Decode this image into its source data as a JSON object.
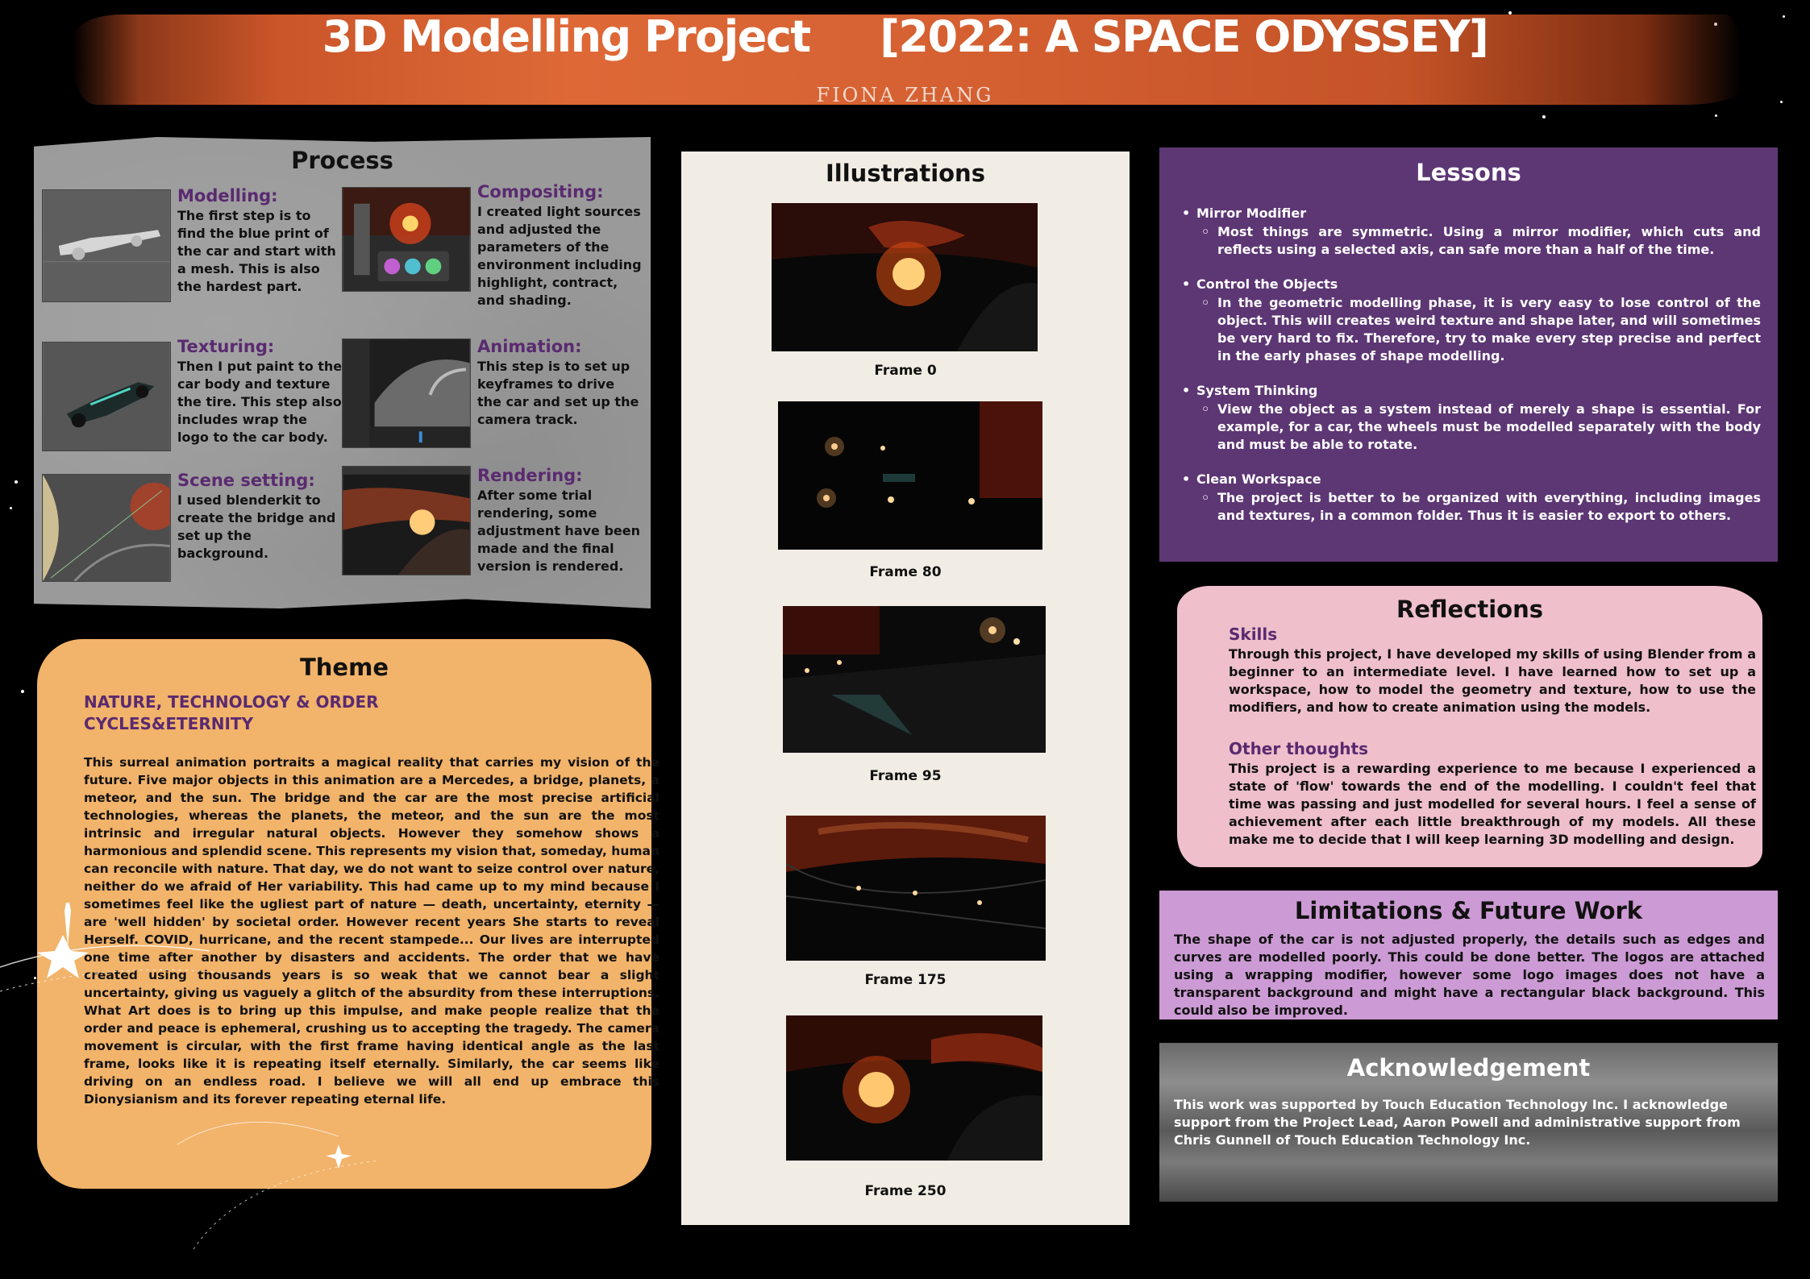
{
  "header": {
    "title": "3D Modelling Project     [2022: A SPACE ODYSSEY]",
    "author": "FIONA ZHANG"
  },
  "process": {
    "title": "Process",
    "steps": [
      {
        "heading": "Modelling:",
        "text": "The first step is to find the blue print of the car and start with a mesh. This is also the hardest part."
      },
      {
        "heading": "Compositing:",
        "text": "I created light sources and adjusted the parameters of the environment including highlight, contract, and shading."
      },
      {
        "heading": "Texturing:",
        "text": "Then I put paint to the car body and texture the tire. This step also includes wrap the logo to the car body."
      },
      {
        "heading": "Animation:",
        "text": "This step is to set up keyframes to drive the car and set up the camera track."
      },
      {
        "heading": "Scene setting:",
        "text": "I used blenderkit to create the bridge and set up the background."
      },
      {
        "heading": "Rendering:",
        "text": "After some trial rendering, some adjustment have been made and the final version is rendered."
      }
    ]
  },
  "theme": {
    "title": "Theme",
    "sub1": "NATURE, TECHNOLOGY & ORDER",
    "sub2": "CYCLES&ETERNITY",
    "body": "This surreal animation portraits a magical reality that carries my vision of the future. Five major objects in this animation are a Mercedes, a bridge, planets, a meteor, and the sun. The bridge and the car are the most precise artificial technologies, whereas the planets, the meteor, and the sun are the most intrinsic and irregular natural objects. However they somehow shows a harmonious and splendid scene. This represents my vision that, someday, human can reconcile with nature. That day, we do not want to seize control over nature, neither do we afraid of Her variability. This had came up to my mind because I sometimes feel like the ugliest part of nature — death, uncertainty, eternity — are 'well hidden' by societal order. However recent years She starts to reveal Herself. COVID, hurricane, and the recent stampede... Our lives are interrupted one time after another by disasters and accidents. The order that we have created using thousands years is so weak that we cannot bear a slight uncertainty, giving us vaguely a glitch of  the absurdity from these interruptions. What Art does is to bring up this impulse, and make people realize that the order and peace is ephemeral, crushing us to accepting the tragedy. The camera movement is circular, with the first frame having identical angle as the last frame, looks like it is repeating itself eternally. Similarly, the car seems like driving on an endless road. I believe we will all end up embrace this Dionysianism and its forever repeating eternal life."
  },
  "illustrations": {
    "title": "Illustrations",
    "frames": [
      "Frame 0",
      "Frame 80",
      "Frame 95",
      "Frame 175",
      "Frame 250"
    ]
  },
  "lessons": {
    "title": "Lessons",
    "items": [
      {
        "head": "Mirror Modifier",
        "text": "Most things are symmetric. Using a mirror modifier, which cuts and reflects using a selected axis, can safe more than a half of the time."
      },
      {
        "head": "Control the Objects",
        "text": "In the geometric modelling phase, it is very easy to lose control of the object. This will creates weird texture and shape later, and will sometimes be very hard to fix. Therefore, try to make every step precise and perfect in the early phases of shape modelling."
      },
      {
        "head": "System Thinking",
        "text": "View the object as a system instead of merely a shape is essential. For example, for a car, the wheels must be modelled separately with the body and must be able to rotate."
      },
      {
        "head": "Clean Workspace",
        "text": "The project is better to be organized with everything, including images and textures, in a common folder. Thus it is easier to export to others."
      }
    ]
  },
  "reflections": {
    "title": "Reflections",
    "skills_head": "Skills",
    "skills_text": "Through this project, I have developed my skills of using Blender from a beginner to an intermediate level. I have learned how to set up a workspace, how to model the geometry and texture, how to use the modifiers, and how to create animation using the models.",
    "other_head": "Other thoughts",
    "other_text": "This project is a rewarding experience to me because I experienced a state of 'flow' towards the end of the modelling. I couldn't feel that time was passing and just modelled for several hours. I feel a sense of achievement after each little breakthrough of my models. All these make me to decide that I will keep learning 3D modelling and design."
  },
  "limitations": {
    "title": "Limitations & Future Work",
    "text": "The shape of the car is not adjusted properly, the details such as edges and curves are modelled poorly. This could be done better. The logos are attached using a wrapping modifier, however some logo images does not have a transparent background and might have a rectangular black background. This could also be improved."
  },
  "acknowledgement": {
    "title": "Acknowledgement",
    "text": "This work was supported by Touch Education Technology Inc. I acknowledge support from the Project Lead, Aaron Powell and administrative support from Chris Gunnell of Touch Education Technology Inc."
  },
  "colors": {
    "background": "#000000",
    "header_brush": "#d0632f",
    "lessons_bg": "#5d3674",
    "reflections_bg": "#efbfcb",
    "limitations_bg": "#cc9ad4",
    "theme_bg": "#f2b36a",
    "illustrations_bg": "#f2ede4",
    "accent_purple": "#5a2a70"
  }
}
